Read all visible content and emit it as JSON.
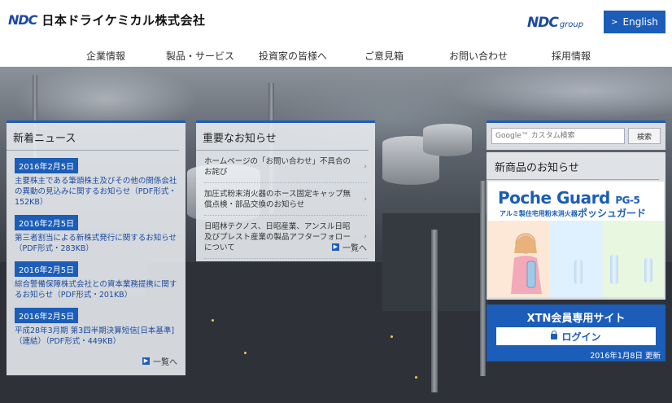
{
  "header": {
    "logo_mark": "NDC",
    "company_name": "日本ドライケミカル株式会社",
    "group_logo_mark": "NDC",
    "group_logo_suffix": "group",
    "english_label": "English"
  },
  "nav": {
    "items": [
      "企業情報",
      "製品・サービス",
      "投資家の皆様へ",
      "ご意見箱",
      "お問い合わせ",
      "採用情報"
    ]
  },
  "news": {
    "title": "新着ニュース",
    "items": [
      {
        "date": "2016年2月5日",
        "text": "主要株主である筆頭株主及びその他の関係会社の異動の見込みに関するお知らせ（PDF形式・152KB）"
      },
      {
        "date": "2016年2月5日",
        "text": "第三者割当による新株式発行に関するお知らせ（PDF形式・283KB）"
      },
      {
        "date": "2016年2月5日",
        "text": "綜合警備保障株式会社との資本業務提携に関するお知らせ（PDF形式・201KB）"
      },
      {
        "date": "2016年2月5日",
        "text": "平成28年3月期 第3四半期決算短信[日本基準]（連結）（PDF形式・449KB）"
      }
    ],
    "more_label": "一覧へ"
  },
  "important": {
    "title": "重要なお知らせ",
    "items": [
      "ホームページの「お問い合わせ」不具合のお詫び",
      "加圧式粉末消火器のホース固定キャップ無償点検・部品交換のお知らせ",
      "日昭林テクノス、日昭産業、アンスル日昭及びプレスト産業の製品アフターフォローについて"
    ],
    "more_label": "一覧へ"
  },
  "search": {
    "placeholder": "Google™ カスタム検索",
    "button_label": "検索"
  },
  "products": {
    "title": "新商品のお知らせ",
    "banner_name": "Poche Guard",
    "banner_model": "PG-5",
    "banner_subtitle": "アルミ製住宅用粉末消火器",
    "banner_kana": "ポッシュガード"
  },
  "xtn": {
    "title": "XTN会員専用サイト",
    "login_label": "ログイン",
    "updated": "2016年1月8日 更新"
  },
  "colors": {
    "accent": "#1b5db8",
    "link": "#1b4aa0"
  }
}
